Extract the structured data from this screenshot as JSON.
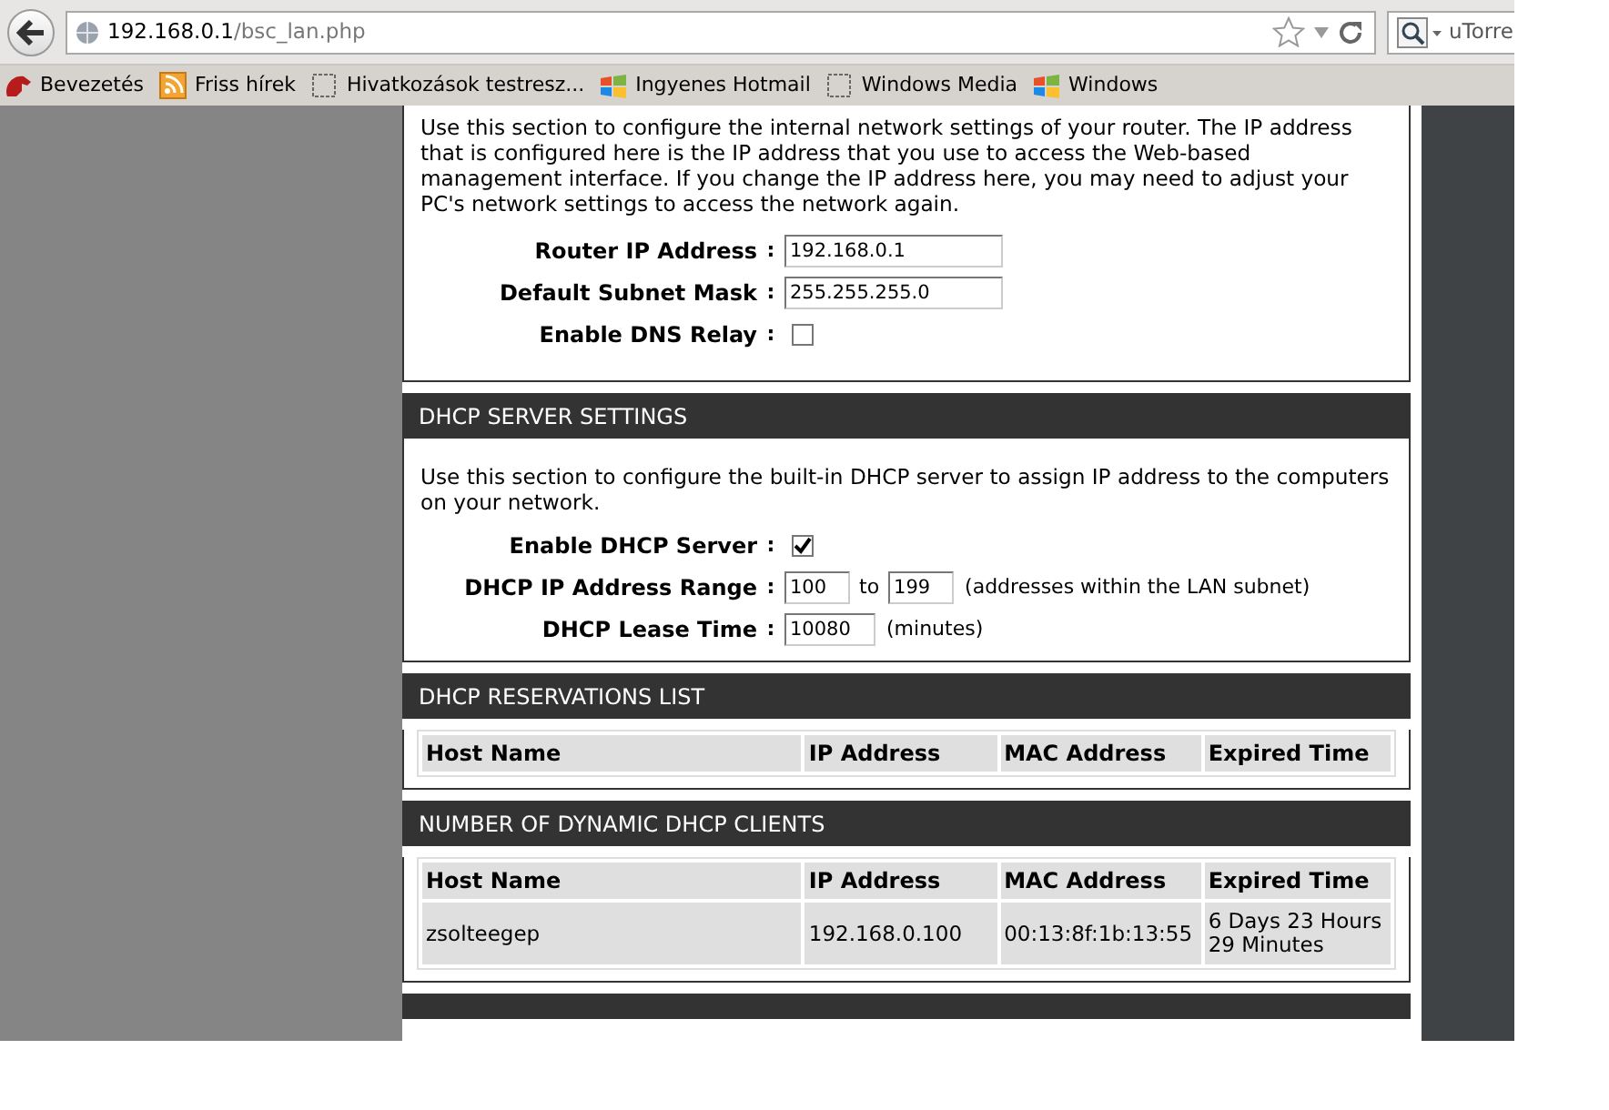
{
  "browser": {
    "url_host": "192.168.0.1",
    "url_path": "/bsc_lan.php",
    "search_text": "uTorre",
    "bookmarks": [
      {
        "label": "Bevezetés"
      },
      {
        "label": "Friss hírek"
      },
      {
        "label": "Hivatkozások testresz..."
      },
      {
        "label": "Ingyenes Hotmail"
      },
      {
        "label": "Windows Media"
      },
      {
        "label": "Windows"
      }
    ]
  },
  "router_settings": {
    "description": "Use this section to configure the internal network settings of your router. The IP address that is configured here is the IP address that you use to access the Web-based management interface. If you change the IP address here, you may need to adjust your PC's network settings to access the network again.",
    "fields": [
      {
        "kind": "text",
        "label": "Router IP Address",
        "separator": ":",
        "value": "192.168.0.1"
      },
      {
        "kind": "text",
        "label": "Default Subnet Mask",
        "separator": ":",
        "value": "255.255.255.0"
      },
      {
        "kind": "checkbox",
        "label": "Enable DNS Relay",
        "separator": ":",
        "checked": false
      }
    ]
  },
  "dhcp_server": {
    "title": "DHCP SERVER SETTINGS",
    "description": "Use this section to configure the built-in DHCP server to assign IP address to the computers on your network.",
    "fields": [
      {
        "kind": "checkbox",
        "label": "Enable DHCP Server",
        "separator": ":",
        "checked": true
      },
      {
        "kind": "range",
        "label": "DHCP IP Address Range",
        "separator": ":",
        "from": "100",
        "to_label": "to",
        "to": "199",
        "note": "(addresses within the LAN subnet)"
      },
      {
        "kind": "lease",
        "label": "DHCP Lease Time",
        "separator": ":",
        "value": "10080",
        "note": "(minutes)"
      }
    ]
  },
  "reservations": {
    "title": "DHCP RESERVATIONS LIST",
    "columns": [
      "Host Name",
      "IP Address",
      "MAC Address",
      "Expired Time"
    ]
  },
  "dynamic_clients": {
    "title": "NUMBER OF DYNAMIC DHCP CLIENTS",
    "columns": [
      "Host Name",
      "IP Address",
      "MAC Address",
      "Expired Time"
    ],
    "rows": [
      [
        "zsolteegep",
        "192.168.0.100",
        "00:13:8f:1b:13:55",
        "6 Days 23 Hours 29 Minutes"
      ]
    ]
  }
}
